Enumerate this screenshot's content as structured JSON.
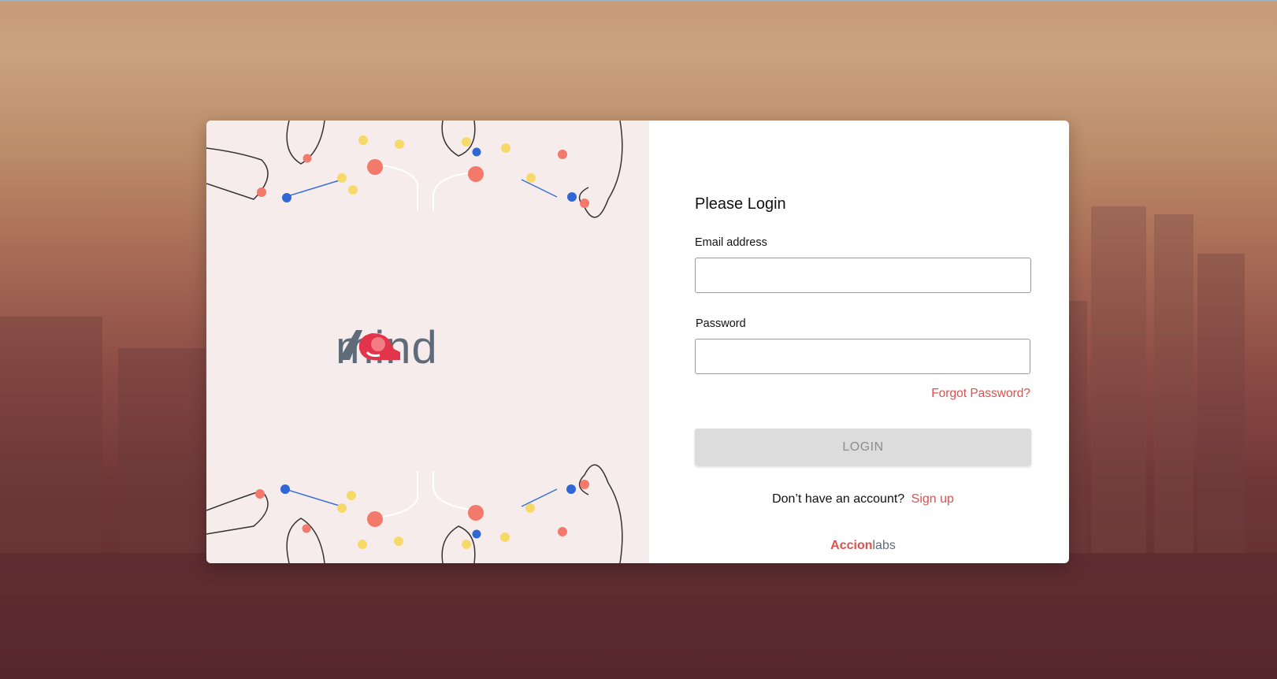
{
  "logo": {
    "word": "mind"
  },
  "login": {
    "title": "Please Login",
    "email_label": "Email address",
    "email_value": "",
    "password_label": "Password",
    "password_value": "",
    "forgot_password": "Forgot Password?",
    "login_button": "LOGIN",
    "no_account_text": "Don’t have an account?",
    "sign_up": "Sign up"
  },
  "footer_brand": {
    "part1": "Accion",
    "part2": "labs"
  },
  "colors": {
    "accent": "#d9534f",
    "logo_gray": "#5f6b78",
    "panel_bg": "#f6ecec",
    "button_disabled": "#dcdcdc"
  }
}
